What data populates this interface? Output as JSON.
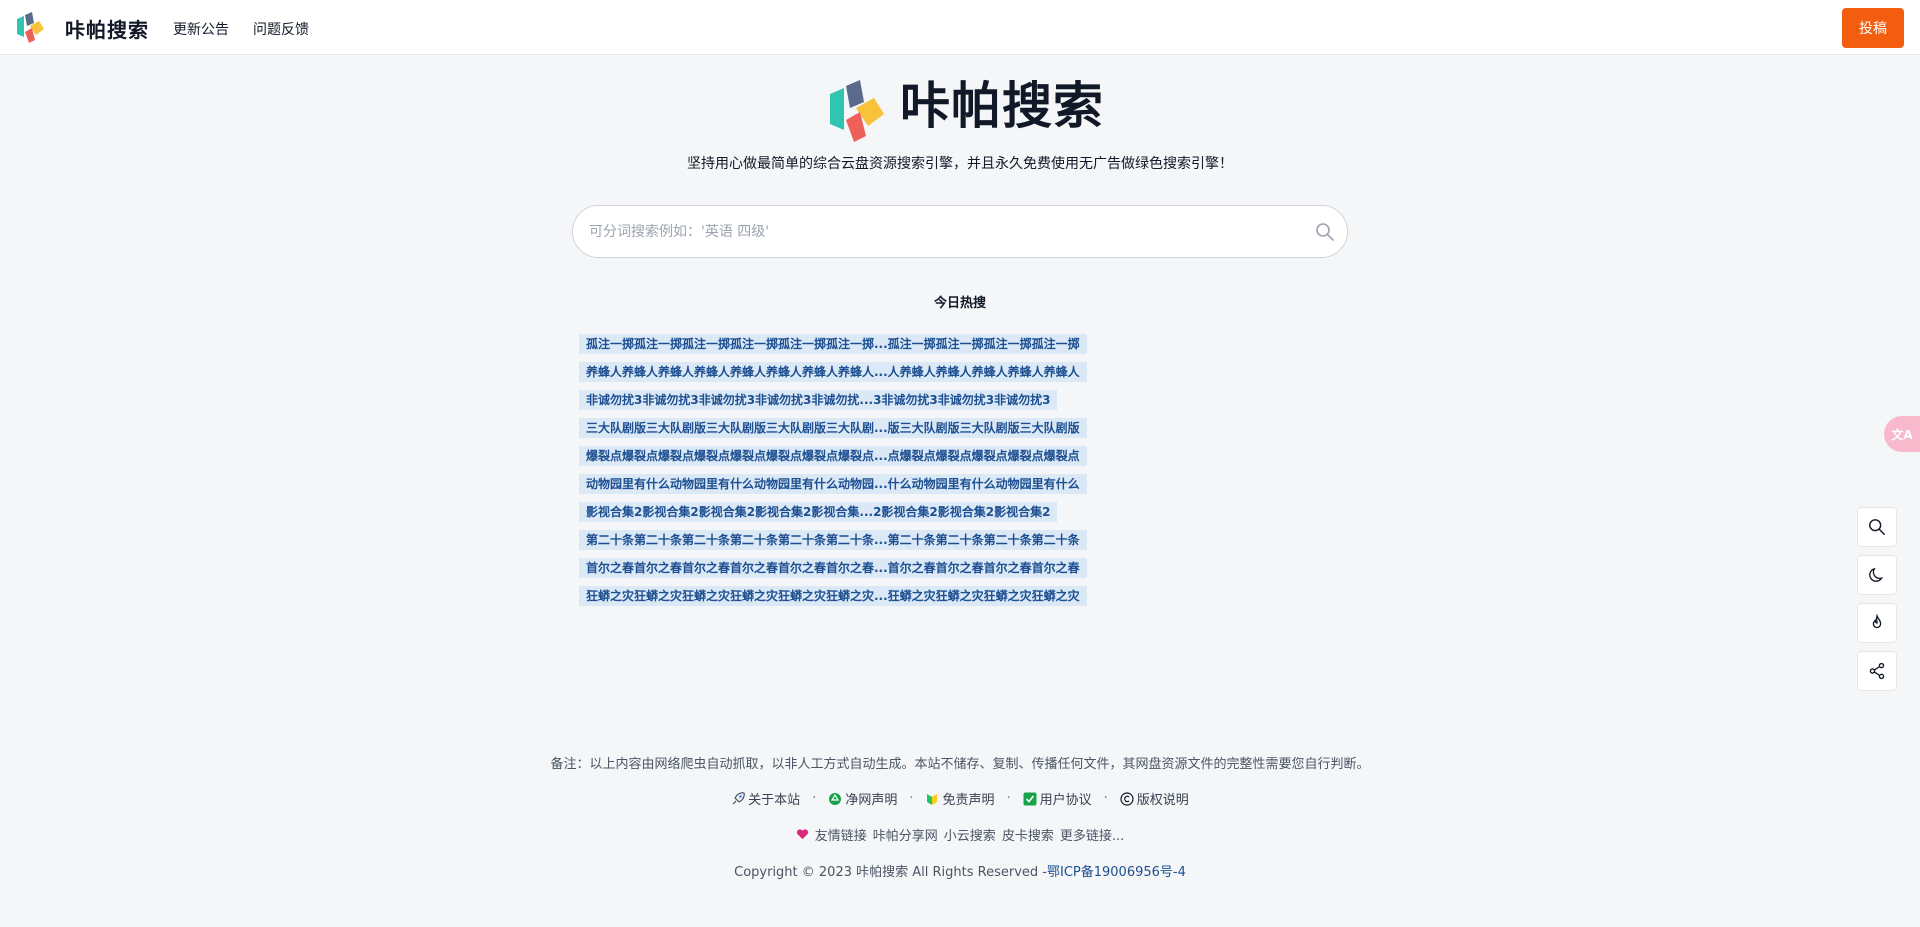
{
  "header": {
    "brand_name": "咔帕搜索",
    "nav": [
      "更新公告",
      "问题反馈"
    ],
    "submit_label": "投稿"
  },
  "hero": {
    "title": "咔帕搜索",
    "slogan": "坚持用心做最简单的综合云盘资源搜索引擎，并且永久免费使用无广告做绿色搜索引擎！"
  },
  "search": {
    "placeholder": "可分词搜索例如：'英语 四级'"
  },
  "hot": {
    "title": "今日热搜",
    "items": [
      "孤注一掷孤注一掷孤注一掷孤注一掷孤注一掷孤注一掷...孤注一掷孤注一掷孤注一掷孤注一掷",
      "养蜂人养蜂人养蜂人养蜂人养蜂人养蜂人养蜂人养蜂人...人养蜂人养蜂人养蜂人养蜂人养蜂人",
      "非诚勿扰3非诚勿扰3非诚勿扰3非诚勿扰3非诚勿扰...3非诚勿扰3非诚勿扰3非诚勿扰3",
      "三大队剧版三大队剧版三大队剧版三大队剧版三大队剧...版三大队剧版三大队剧版三大队剧版",
      "爆裂点爆裂点爆裂点爆裂点爆裂点爆裂点爆裂点爆裂点...点爆裂点爆裂点爆裂点爆裂点爆裂点",
      "动物园里有什么动物园里有什么动物园里有什么动物园...什么动物园里有什么动物园里有什么",
      "影视合集2影视合集2影视合集2影视合集2影视合集...2影视合集2影视合集2影视合集2",
      "第二十条第二十条第二十条第二十条第二十条第二十条...第二十条第二十条第二十条第二十条",
      "首尔之春首尔之春首尔之春首尔之春首尔之春首尔之春...首尔之春首尔之春首尔之春首尔之春",
      "狂蟒之灾狂蟒之灾狂蟒之灾狂蟒之灾狂蟒之灾狂蟒之灾...狂蟒之灾狂蟒之灾狂蟒之灾狂蟒之灾"
    ]
  },
  "side_tools": {
    "translate_label": "文A",
    "icons": [
      "search-icon",
      "moon-icon",
      "fire-icon",
      "share-icon"
    ]
  },
  "footer": {
    "note": "备注：以上内容由网络爬虫自动抓取，以非人工方式自动生成。本站不储存、复制、传播任何文件，其网盘资源文件的完整性需要您自行判断。",
    "links": [
      "关于本站",
      "净网声明",
      "免责声明",
      "用户协议",
      "版权说明"
    ],
    "separator": "·",
    "friend_label": "友情链接",
    "friend_links": [
      "咔帕分享网",
      "小云搜索",
      "皮卡搜索",
      "更多链接..."
    ],
    "copyright_text": "Copyright © 2023 咔帕搜索 All Rights Reserved -",
    "icp": "鄂ICP备19006956号-4"
  },
  "colors": {
    "accent": "#f25d10",
    "hot_bg": "#dbe8f6",
    "hot_text": "#1d4f91",
    "page_bg": "#f4f6f8"
  }
}
